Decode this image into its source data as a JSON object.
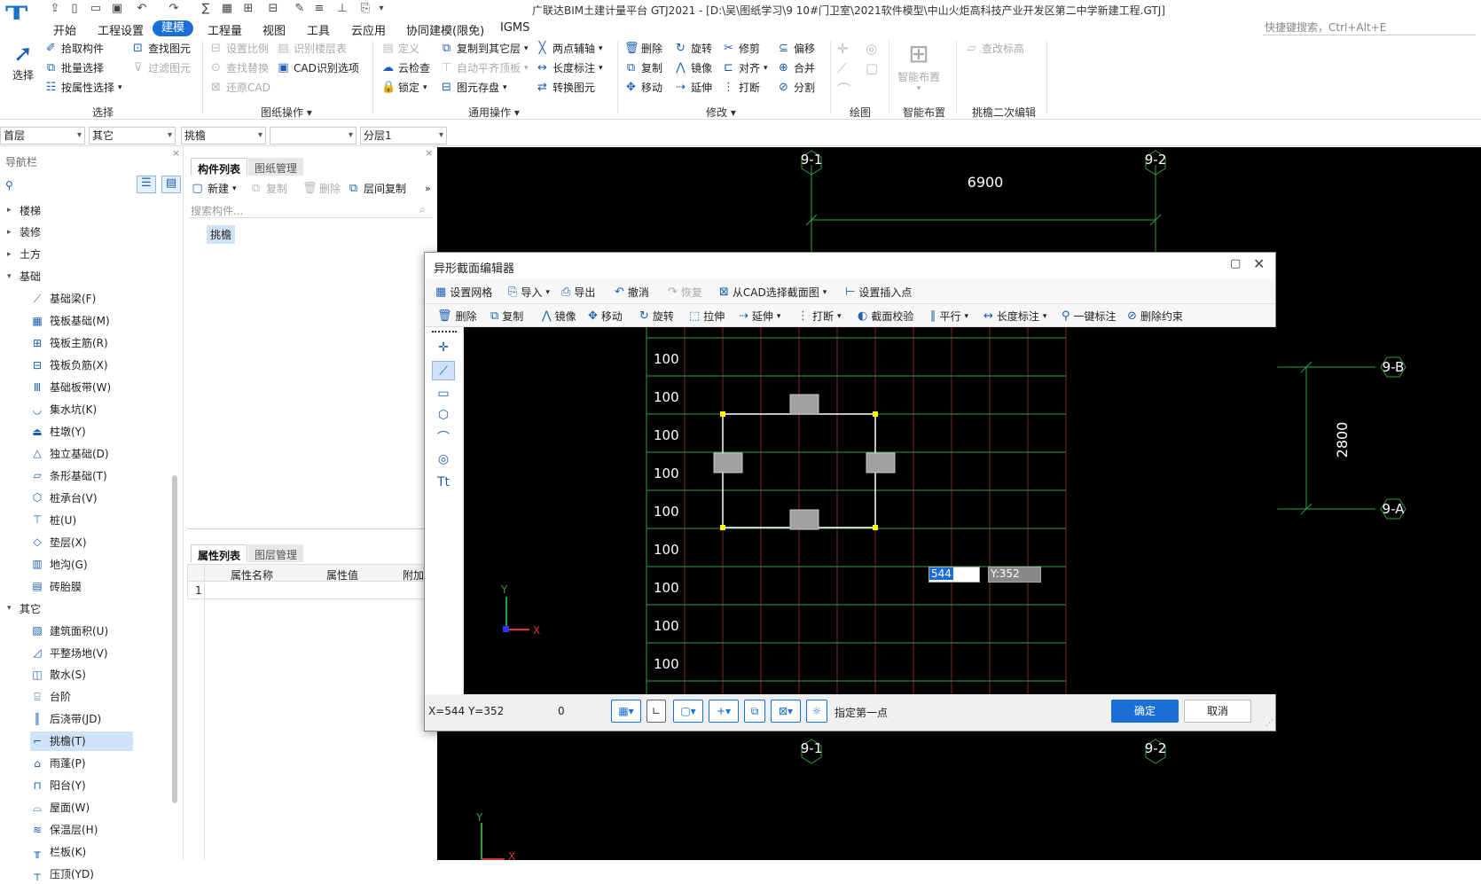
{
  "app": {
    "title": "广联达BIM土建计量平台 GTJ2021 - [D:\\吴\\图纸学习\\9 10#门卫室\\2021软件模型\\中山火炬高科技产业开发区第二中学新建工程.GTJ]",
    "logo": "T",
    "search_placeholder": "快捷键搜索，Ctrl+Alt+E"
  },
  "menus": [
    "开始",
    "工程设置",
    "建模",
    "工程量",
    "视图",
    "工具",
    "云应用",
    "协同建模(限免)",
    "IGMS"
  ],
  "active_menu": "建模",
  "ribbon": {
    "select_big": "选择",
    "select_col": [
      "拾取构件",
      "批量选择",
      "按属性选择"
    ],
    "find_col": [
      "查找图元",
      "过滤图元"
    ],
    "drawing_col1": [
      "设置比例",
      "查找替换",
      "还原CAD"
    ],
    "drawing_col2": [
      "识别楼层表",
      "CAD识别选项"
    ],
    "common_col1": [
      "定义",
      "云检查",
      "锁定"
    ],
    "common_col2": [
      "复制到其它层",
      "自动平齐顶板",
      "图元存盘"
    ],
    "common_col3": [
      "两点辅轴",
      "长度标注",
      "转换图元"
    ],
    "modify_col1": [
      "删除",
      "复制",
      "移动"
    ],
    "modify_col2": [
      "旋转",
      "镜像",
      "延伸"
    ],
    "modify_col3": [
      "修剪",
      "对齐",
      "打断"
    ],
    "modify_col4": [
      "偏移",
      "合并",
      "分割"
    ],
    "smart": "智能布置",
    "edit_height": "查改标高",
    "groups": [
      "选择",
      "图纸操作",
      "通用操作",
      "修改",
      "绘图",
      "智能布置",
      "挑檐二次编辑"
    ]
  },
  "selectors": [
    "首层",
    "其它",
    "挑檐",
    "",
    "分层1"
  ],
  "nav": {
    "title": "导航栏",
    "items": [
      {
        "label": "楼梯",
        "level": 0,
        "icon": "▸"
      },
      {
        "label": "装修",
        "level": 0,
        "icon": "▸"
      },
      {
        "label": "土方",
        "level": 0,
        "icon": "▸"
      },
      {
        "label": "基础",
        "level": 0,
        "icon": "▾"
      },
      {
        "label": "基础梁(F)",
        "level": 1,
        "icon": "⟋"
      },
      {
        "label": "筏板基础(M)",
        "level": 1,
        "icon": "▦"
      },
      {
        "label": "筏板主筋(R)",
        "level": 1,
        "icon": "⊞"
      },
      {
        "label": "筏板负筋(X)",
        "level": 1,
        "icon": "⊟"
      },
      {
        "label": "基础板带(W)",
        "level": 1,
        "icon": "Ⅲ"
      },
      {
        "label": "集水坑(K)",
        "level": 1,
        "icon": "◡"
      },
      {
        "label": "柱墩(Y)",
        "level": 1,
        "icon": "⏏"
      },
      {
        "label": "独立基础(D)",
        "level": 1,
        "icon": "△"
      },
      {
        "label": "条形基础(T)",
        "level": 1,
        "icon": "▱"
      },
      {
        "label": "桩承台(V)",
        "level": 1,
        "icon": "⬡"
      },
      {
        "label": "桩(U)",
        "level": 1,
        "icon": "⊤"
      },
      {
        "label": "垫层(X)",
        "level": 1,
        "icon": "◇"
      },
      {
        "label": "地沟(G)",
        "level": 1,
        "icon": "▥"
      },
      {
        "label": "砖胎膜",
        "level": 1,
        "icon": "▤"
      },
      {
        "label": "其它",
        "level": 0,
        "icon": "▾"
      },
      {
        "label": "建筑面积(U)",
        "level": 1,
        "icon": "▨"
      },
      {
        "label": "平整场地(V)",
        "level": 1,
        "icon": "◿"
      },
      {
        "label": "散水(S)",
        "level": 1,
        "icon": "◫"
      },
      {
        "label": "台阶",
        "level": 1,
        "icon": "⌸"
      },
      {
        "label": "后浇带(JD)",
        "level": 1,
        "icon": "║"
      },
      {
        "label": "挑檐(T)",
        "level": 1,
        "icon": "⌐"
      },
      {
        "label": "雨蓬(P)",
        "level": 1,
        "icon": "⌂"
      },
      {
        "label": "阳台(Y)",
        "level": 1,
        "icon": "⊓"
      },
      {
        "label": "屋面(W)",
        "level": 1,
        "icon": "⌓"
      },
      {
        "label": "保温层(H)",
        "level": 1,
        "icon": "≋"
      },
      {
        "label": "栏板(K)",
        "level": 1,
        "icon": "╥"
      },
      {
        "label": "压顶(YD)",
        "level": 1,
        "icon": "┬"
      }
    ],
    "selected": "挑檐(T)"
  },
  "comp": {
    "tabs": [
      "构件列表",
      "图纸管理"
    ],
    "toolbar": [
      "新建",
      "复制",
      "删除",
      "层间复制"
    ],
    "search_placeholder": "搜索构件...",
    "items": [
      "挑檐"
    ],
    "prop_tabs": [
      "属性列表",
      "图层管理"
    ],
    "prop_headers": [
      "属性名称",
      "属性值",
      "附加"
    ],
    "prop_rows": [
      "1"
    ]
  },
  "cad": {
    "axes_top": [
      "9-1",
      "9-2"
    ],
    "axes_bottom": [
      "9-1",
      "9-2"
    ],
    "axes_right": [
      "9-B",
      "9-A"
    ],
    "dim_top": "6900",
    "dim_right": "2800"
  },
  "dialog": {
    "title": "异形截面编辑器",
    "toolbar1": [
      "设置网格",
      "导入",
      "导出",
      "撤消",
      "恢复",
      "从CAD选择截面图",
      "设置插入点"
    ],
    "toolbar2": [
      "删除",
      "复制",
      "镜像",
      "移动",
      "旋转",
      "拉伸",
      "延伸",
      "打断",
      "截面校验",
      "平行",
      "长度标注",
      "一键标注",
      "删除约束"
    ],
    "grid_labels": [
      "100",
      "100",
      "100",
      "100",
      "100",
      "100",
      "100",
      "100",
      "100"
    ],
    "input_x": "544",
    "input_y": "Y:352",
    "status_coord": "X=544 Y=352",
    "status_num": "0",
    "status_hint": "指定第一点",
    "ok": "确定",
    "cancel": "取消"
  },
  "axis_labels": {
    "x": "X",
    "y": "Y"
  }
}
